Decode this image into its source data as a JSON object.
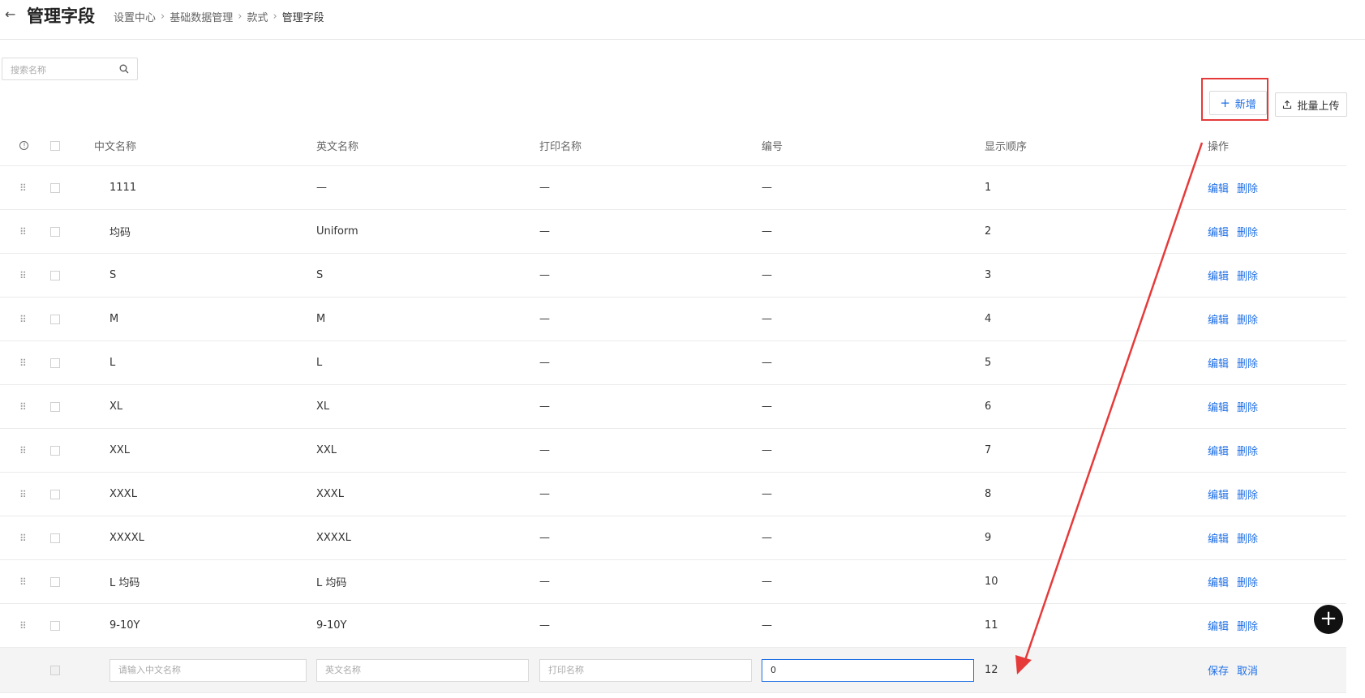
{
  "header": {
    "back_icon": "arrow-left-icon",
    "title": "管理字段",
    "breadcrumbs": [
      "设置中心",
      "基础数据管理",
      "款式",
      "管理字段"
    ],
    "separator": "›"
  },
  "search": {
    "placeholder": "搜索名称",
    "icon": "search-icon"
  },
  "toolbar": {
    "add_label": "新增",
    "add_icon": "plus-icon",
    "upload_label": "批量上传",
    "upload_icon": "upload-icon"
  },
  "table": {
    "columns": [
      "中文名称",
      "英文名称",
      "打印名称",
      "编号",
      "显示顺序",
      "操作"
    ],
    "edit_label": "编辑",
    "delete_label": "删除",
    "rows": [
      {
        "cn": "1111",
        "en": "—",
        "print": "—",
        "num": "—",
        "order": "1"
      },
      {
        "cn": "均码",
        "en": "Uniform",
        "print": "—",
        "num": "—",
        "order": "2"
      },
      {
        "cn": "S",
        "en": "S",
        "print": "—",
        "num": "—",
        "order": "3"
      },
      {
        "cn": "M",
        "en": "M",
        "print": "—",
        "num": "—",
        "order": "4"
      },
      {
        "cn": "L",
        "en": "L",
        "print": "—",
        "num": "—",
        "order": "5"
      },
      {
        "cn": "XL",
        "en": "XL",
        "print": "—",
        "num": "—",
        "order": "6"
      },
      {
        "cn": "XXL",
        "en": "XXL",
        "print": "—",
        "num": "—",
        "order": "7"
      },
      {
        "cn": "XXXL",
        "en": "XXXL",
        "print": "—",
        "num": "—",
        "order": "8"
      },
      {
        "cn": "XXXXL",
        "en": "XXXXL",
        "print": "—",
        "num": "—",
        "order": "9"
      },
      {
        "cn": "L 均码",
        "en": "L 均码",
        "print": "—",
        "num": "—",
        "order": "10"
      },
      {
        "cn": "9-10Y",
        "en": "9-10Y",
        "print": "—",
        "num": "—",
        "order": "11"
      }
    ],
    "new_row": {
      "cn_placeholder": "请输入中文名称",
      "en_placeholder": "英文名称",
      "print_placeholder": "打印名称",
      "num_value": "0",
      "order": "12",
      "save_label": "保存",
      "cancel_label": "取消"
    }
  },
  "fab": {
    "icon": "plus-icon"
  },
  "colors": {
    "accent": "#1f6fe6",
    "highlight": "#e63a3a",
    "fab": "#111111"
  }
}
